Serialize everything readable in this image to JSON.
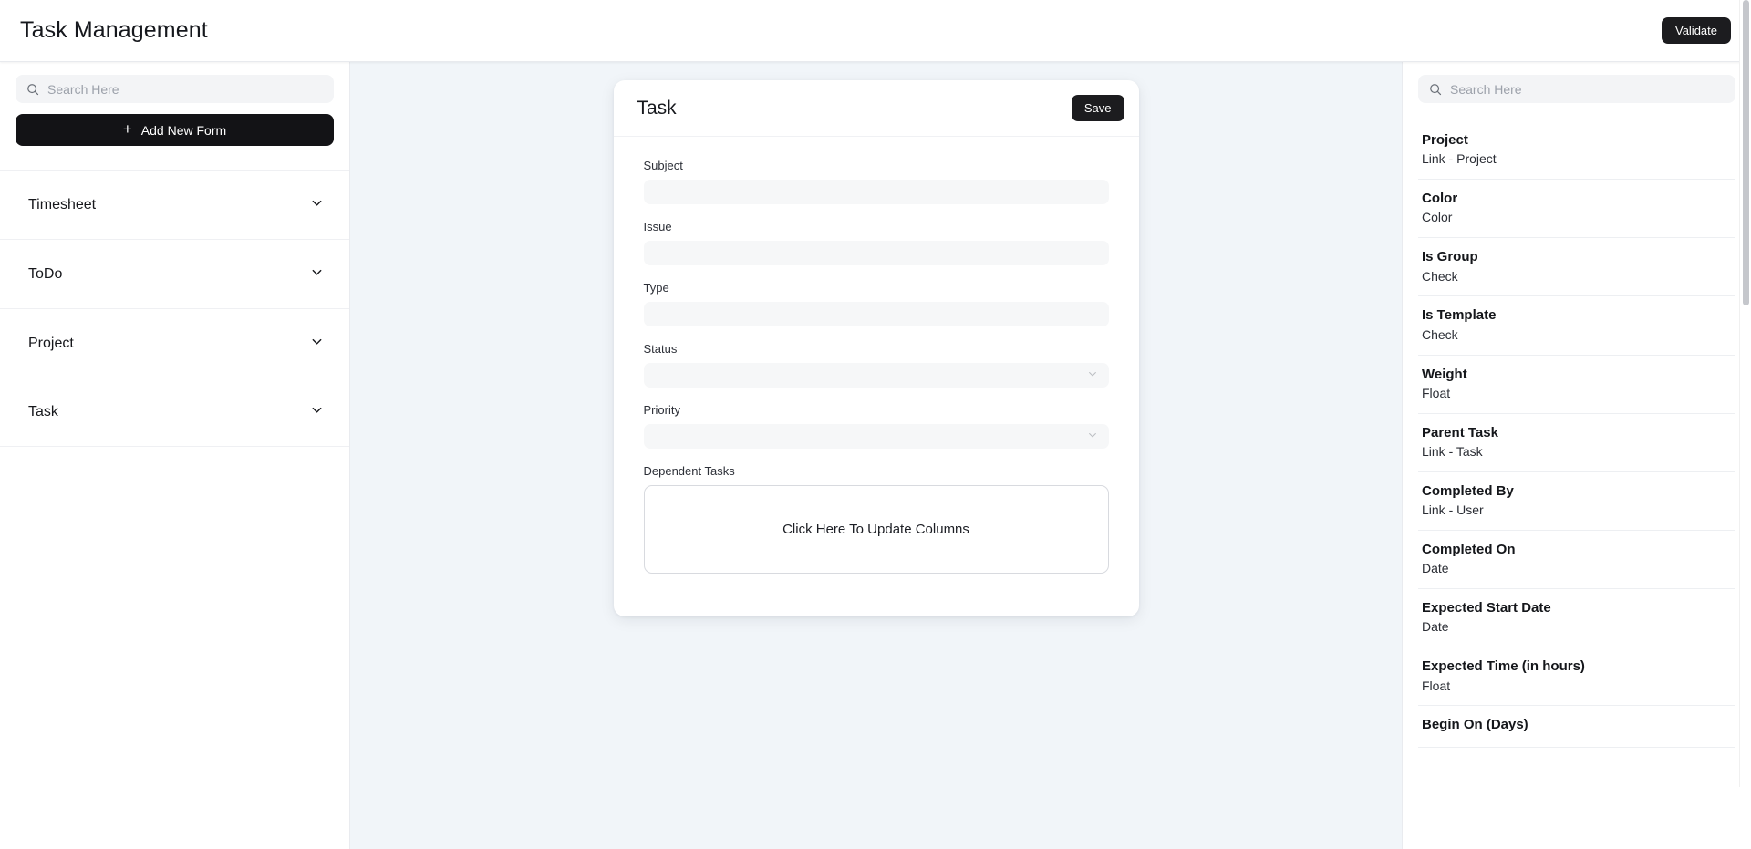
{
  "header": {
    "title": "Task Management",
    "validate_label": "Validate"
  },
  "sidebar": {
    "search": {
      "placeholder": "Search Here",
      "value": "",
      "icon": "search-icon"
    },
    "add_form_label": "Add New Form",
    "add_form_icon": "plus-icon",
    "items": [
      {
        "label": "Timesheet",
        "icon": "chevron-down-icon"
      },
      {
        "label": "ToDo",
        "icon": "chevron-down-icon"
      },
      {
        "label": "Project",
        "icon": "chevron-down-icon"
      },
      {
        "label": "Task",
        "icon": "chevron-down-icon"
      }
    ]
  },
  "form_card": {
    "title": "Task",
    "save_label": "Save",
    "fields": [
      {
        "label": "Subject",
        "value": "",
        "placeholder": "",
        "control": "text"
      },
      {
        "label": "Issue",
        "value": "",
        "placeholder": "",
        "control": "text"
      },
      {
        "label": "Type",
        "value": "",
        "placeholder": "",
        "control": "text"
      },
      {
        "label": "Status",
        "value": "",
        "placeholder": "",
        "control": "select"
      },
      {
        "label": "Priority",
        "value": "",
        "placeholder": "",
        "control": "select"
      }
    ],
    "dependent_tasks": {
      "label": "Dependent Tasks",
      "dropzone_text": "Click Here To Update Columns"
    }
  },
  "right_panel": {
    "search": {
      "placeholder": "Search Here",
      "value": "",
      "icon": "search-icon"
    },
    "fields": [
      {
        "name": "Project",
        "type": "Link  - Project"
      },
      {
        "name": "Color",
        "type": "Color"
      },
      {
        "name": "Is Group",
        "type": "Check"
      },
      {
        "name": "Is Template",
        "type": "Check"
      },
      {
        "name": "Weight",
        "type": "Float"
      },
      {
        "name": "Parent Task",
        "type": "Link  - Task"
      },
      {
        "name": "Completed By",
        "type": "Link  - User"
      },
      {
        "name": "Completed On",
        "type": "Date"
      },
      {
        "name": "Expected Start Date",
        "type": "Date"
      },
      {
        "name": "Expected Time (in hours)",
        "type": "Float"
      },
      {
        "name": "Begin On (Days)",
        "type": ""
      }
    ]
  },
  "colors": {
    "accent_dark": "#1c1c1f",
    "canvas_bg": "#f1f5f9",
    "panel_bg": "#ffffff",
    "input_bg": "#f6f7f8",
    "border": "#e9ebef"
  }
}
